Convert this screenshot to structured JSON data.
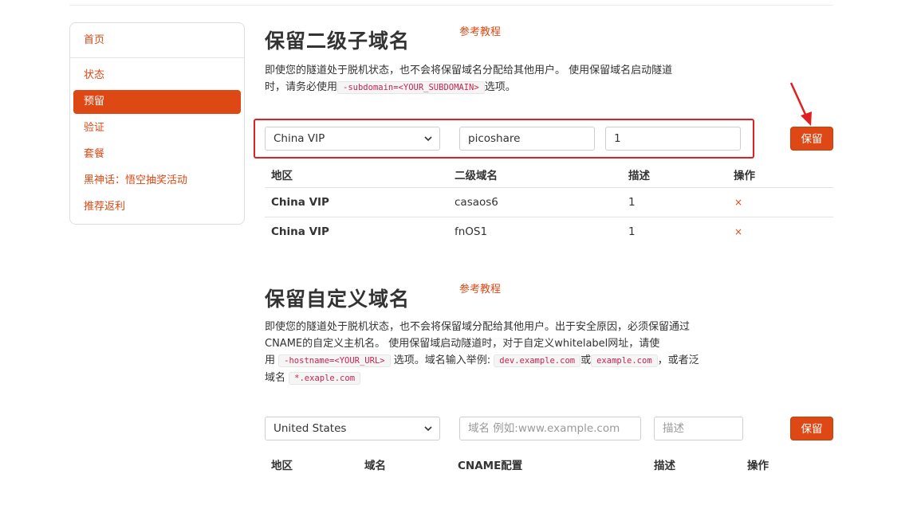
{
  "sidebar": {
    "items": [
      {
        "label": "首页"
      },
      {
        "label": "状态"
      },
      {
        "label": "预留"
      },
      {
        "label": "验证"
      },
      {
        "label": "套餐"
      },
      {
        "label": "黑神话：悟空抽奖活动"
      },
      {
        "label": "推荐返利"
      }
    ],
    "active_index": 2
  },
  "subdomain_section": {
    "title": "保留二级子域名",
    "ref_link": "参考教程",
    "desc_line1": "即使您的隧道处于脱机状态，也不会将保留域名分配给其他用户。 使用保留域名启动隧道",
    "desc_line2_pre": "时，请务必使用",
    "code": "-subdomain=<YOUR_SUBDOMAIN>",
    "desc_line2_post": "选项。",
    "form": {
      "region_value": "China VIP",
      "subdomain_value": "picoshare",
      "desc_value": "1",
      "submit_label": "保留"
    },
    "table": {
      "headers": [
        "地区",
        "二级域名",
        "描述",
        "操作"
      ],
      "rows": [
        {
          "region": "China VIP",
          "subdomain": "casaos6",
          "desc": "1",
          "action": "×"
        },
        {
          "region": "China VIP",
          "subdomain": "fnOS1",
          "desc": "1",
          "action": "×"
        }
      ]
    }
  },
  "custom_section": {
    "title": "保留自定义域名",
    "ref_link": "参考教程",
    "desc_line1": "即使您的隧道处于脱机状态，也不会将保留域分配给其他用户。出于安全原因，必须保留通过",
    "desc_line2": "CNAME的自定义主机名。 使用保留域启动隧道时，对于自定义whitelabel网址，请使",
    "desc_line3_a": "用",
    "code_hostname": "-hostname=<YOUR_URL>",
    "desc_line3_b": "选项。域名输入举例:",
    "code_example1": "dev.example.com",
    "desc_line3_c": "或",
    "code_example2": "example.com",
    "desc_line3_d": "，或者泛",
    "desc_line4": "域名",
    "code_example3": "*.exaple.com",
    "form": {
      "region_value": "United States",
      "domain_placeholder": "域名 例如:www.example.com",
      "desc_placeholder": "描述",
      "submit_label": "保留"
    },
    "table": {
      "headers": [
        "地区",
        "域名",
        "CNAME配置",
        "描述",
        "操作"
      ]
    }
  },
  "colors": {
    "accent": "#dd4814",
    "highlight_box": "#e02020"
  }
}
